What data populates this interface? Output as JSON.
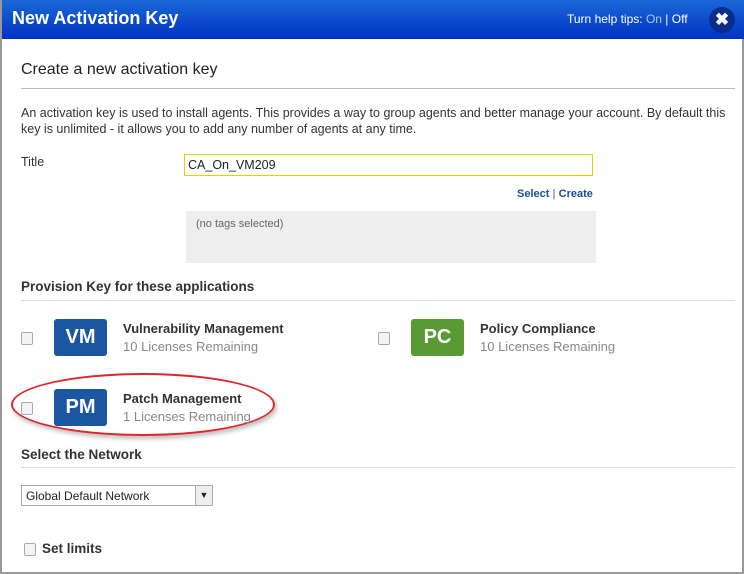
{
  "dialog": {
    "title": "New Activation Key",
    "help_prefix": "Turn help tips:",
    "help_on": "On",
    "help_sep": "|",
    "help_off": "Off",
    "close_icon": "close-icon"
  },
  "form": {
    "subtitle": "Create a new activation key",
    "description": "An activation key is used to install agents. This provides a way to group agents and better manage your account. By default this key is unlimited - it allows you to add any number of agents at any time.",
    "title_label": "Title",
    "title_value": "CA_On_VM209",
    "tags_select": "Select",
    "tags_sep": "|",
    "tags_create": "Create",
    "tags_empty": "(no tags selected)"
  },
  "provision": {
    "heading": "Provision Key for these applications",
    "apps": [
      {
        "abbr": "VM",
        "name": "Vulnerability Management",
        "licenses": "10 Licenses Remaining",
        "color": "#1b56a0",
        "checked": false
      },
      {
        "abbr": "PC",
        "name": "Policy Compliance",
        "licenses": "10 Licenses Remaining",
        "color": "#5a9a32",
        "checked": false
      },
      {
        "abbr": "PM",
        "name": "Patch Management",
        "licenses": "1 Licenses Remaining",
        "color": "#1b56a0",
        "checked": false,
        "highlighted": true
      }
    ]
  },
  "network": {
    "heading": "Select the Network",
    "selected": "Global Default Network"
  },
  "limits": {
    "label": "Set limits",
    "checked": false
  }
}
